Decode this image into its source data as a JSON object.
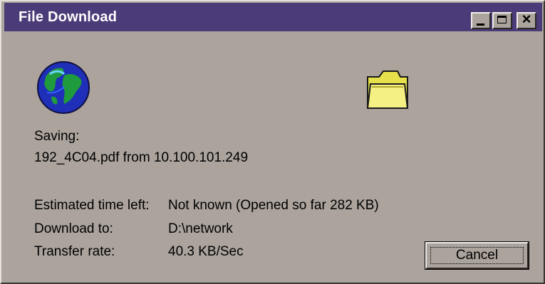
{
  "window": {
    "title": "File Download"
  },
  "icons": {
    "globe": "globe-icon",
    "folder": "folder-icon"
  },
  "saving": {
    "label": "Saving:",
    "file_line": "192_4C04.pdf from 10.100.101.249"
  },
  "details": {
    "time_left_label": "Estimated time left:",
    "time_left_value": "Not known (Opened so far 282 KB)",
    "download_to_label": "Download to:",
    "download_to_value": "D:\\network",
    "transfer_rate_label": "Transfer rate:",
    "transfer_rate_value": "40.3 KB/Sec"
  },
  "buttons": {
    "cancel_label": "Cancel"
  },
  "colors": {
    "title_bar": "#4b3b78",
    "dialog_face": "#aba39c"
  }
}
